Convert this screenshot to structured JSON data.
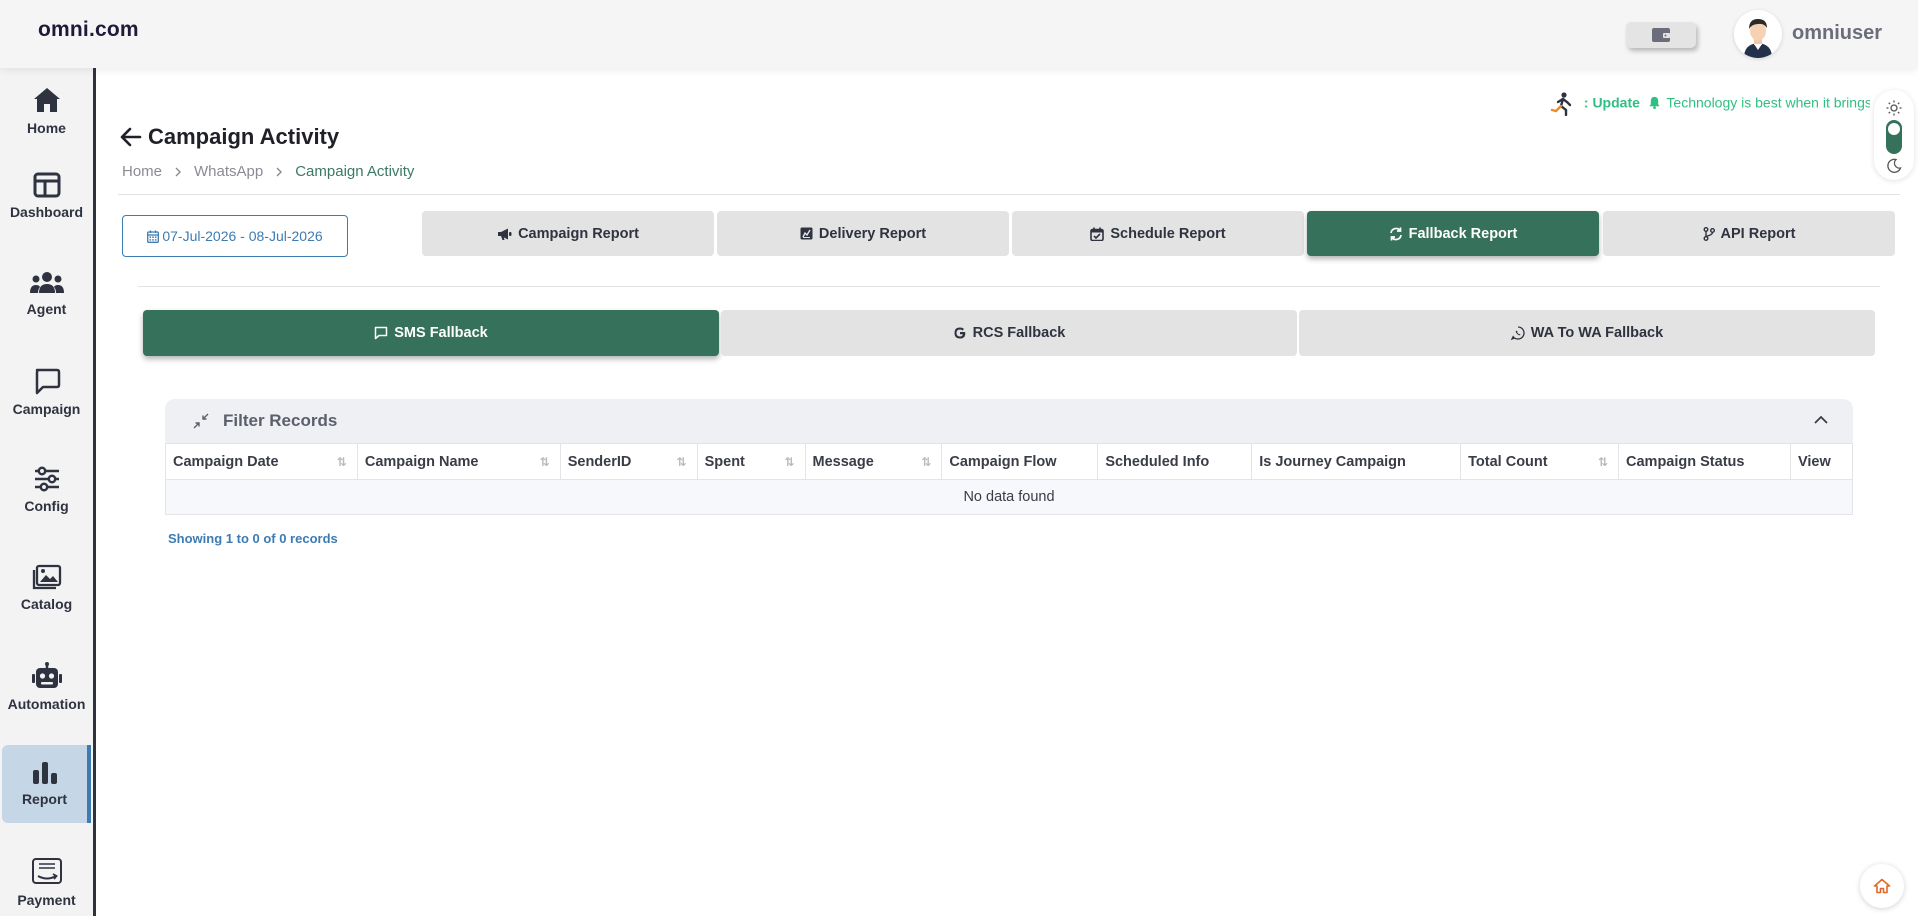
{
  "app": {
    "logo": "omni.com",
    "username": "omniuser"
  },
  "sidebar": {
    "items": [
      {
        "label": "Home",
        "icon": "home-icon"
      },
      {
        "label": "Dashboard",
        "icon": "dashboard-icon"
      },
      {
        "label": "Agent",
        "icon": "users-icon"
      },
      {
        "label": "Campaign",
        "icon": "chat-icon"
      },
      {
        "label": "Config",
        "icon": "sliders-icon"
      },
      {
        "label": "Catalog",
        "icon": "image-icon"
      },
      {
        "label": "Automation",
        "icon": "robot-icon"
      },
      {
        "label": "Report",
        "icon": "bar-chart-icon",
        "active": true
      },
      {
        "label": "Payment",
        "icon": "amazon-pay-icon"
      }
    ]
  },
  "update": {
    "prefix": ": Update",
    "message": "Technology is best when it brings people together."
  },
  "page": {
    "title": "Campaign Activity"
  },
  "breadcrumb": {
    "home": "Home",
    "section": "WhatsApp",
    "current": "Campaign Activity"
  },
  "date_range": "07-Jul-2026 - 08-Jul-2026",
  "report_tabs": [
    {
      "label": "Campaign Report",
      "icon": "megaphone-icon"
    },
    {
      "label": "Delivery Report",
      "icon": "report-icon"
    },
    {
      "label": "Schedule Report",
      "icon": "calendar-check-icon"
    },
    {
      "label": "Fallback Report",
      "icon": "refresh-icon",
      "active": true
    },
    {
      "label": "API Report",
      "icon": "branch-icon"
    }
  ],
  "fallback_tabs": [
    {
      "label": "SMS Fallback",
      "icon": "message-square-icon",
      "active": true
    },
    {
      "label": "RCS Fallback",
      "icon": "google-icon"
    },
    {
      "label": "WA To WA Fallback",
      "icon": "whatsapp-icon"
    }
  ],
  "filter": {
    "title": "Filter Records"
  },
  "table": {
    "columns": [
      "Campaign Date",
      "Campaign Name",
      "SenderID",
      "Spent",
      "Message",
      "Campaign Flow",
      "Scheduled Info",
      "Is Journey Campaign",
      "Total Count",
      "Campaign Status",
      "View"
    ],
    "empty_text": "No data found",
    "showing": "Showing 1 to 0 of 0 records"
  },
  "colors": {
    "primary_green": "#36715c",
    "accent_blue": "#3d7bb3",
    "update_green": "#2fbf82"
  }
}
